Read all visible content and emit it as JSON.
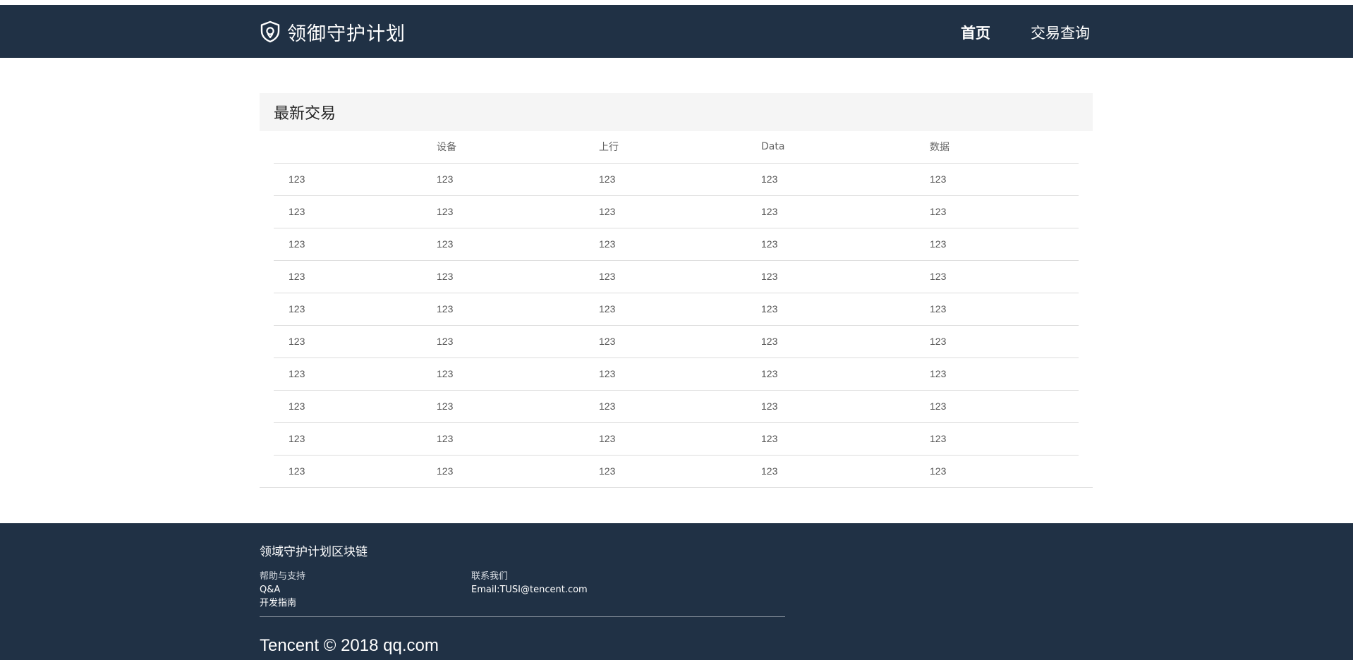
{
  "header": {
    "brand": "领御守护计划",
    "nav": {
      "home": "首页",
      "query": "交易查询"
    }
  },
  "panel": {
    "title": "最新交易",
    "columns": [
      "",
      "设备",
      "上行",
      "Data",
      "数据"
    ],
    "rows": [
      [
        "123",
        "123",
        "123",
        "123",
        "123"
      ],
      [
        "123",
        "123",
        "123",
        "123",
        "123"
      ],
      [
        "123",
        "123",
        "123",
        "123",
        "123"
      ],
      [
        "123",
        "123",
        "123",
        "123",
        "123"
      ],
      [
        "123",
        "123",
        "123",
        "123",
        "123"
      ],
      [
        "123",
        "123",
        "123",
        "123",
        "123"
      ],
      [
        "123",
        "123",
        "123",
        "123",
        "123"
      ],
      [
        "123",
        "123",
        "123",
        "123",
        "123"
      ],
      [
        "123",
        "123",
        "123",
        "123",
        "123"
      ],
      [
        "123",
        "123",
        "123",
        "123",
        "123"
      ]
    ]
  },
  "footer": {
    "title": "领域守护计划区块链",
    "help": {
      "heading": "帮助与支持",
      "qa": "Q&A",
      "guide": "开发指南"
    },
    "contact": {
      "heading": "联系我们",
      "email": "Email:TUSI@tencent.com"
    },
    "copyright": "Tencent © 2018 qq.com"
  },
  "colors": {
    "header_bg": "#203145",
    "footer_bg": "#203145",
    "panel_head_bg": "#f5f5f5"
  },
  "icons": {
    "brand": "shield-icon"
  }
}
